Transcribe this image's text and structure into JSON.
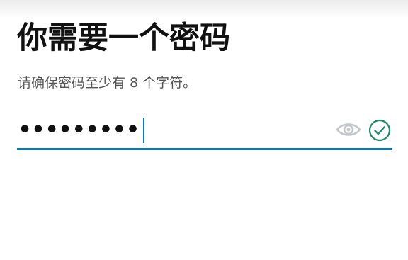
{
  "header": {
    "title": "你需要一个密码",
    "subtitle": "请确保密码至少有 8 个字符。"
  },
  "password_field": {
    "masked_value": "•••••••••",
    "icons": {
      "reveal": "eye-icon",
      "valid": "check-circle-icon"
    }
  },
  "colors": {
    "accent": "#0f7db0",
    "valid": "#1f8a63",
    "eye": "#c2c7cc"
  }
}
